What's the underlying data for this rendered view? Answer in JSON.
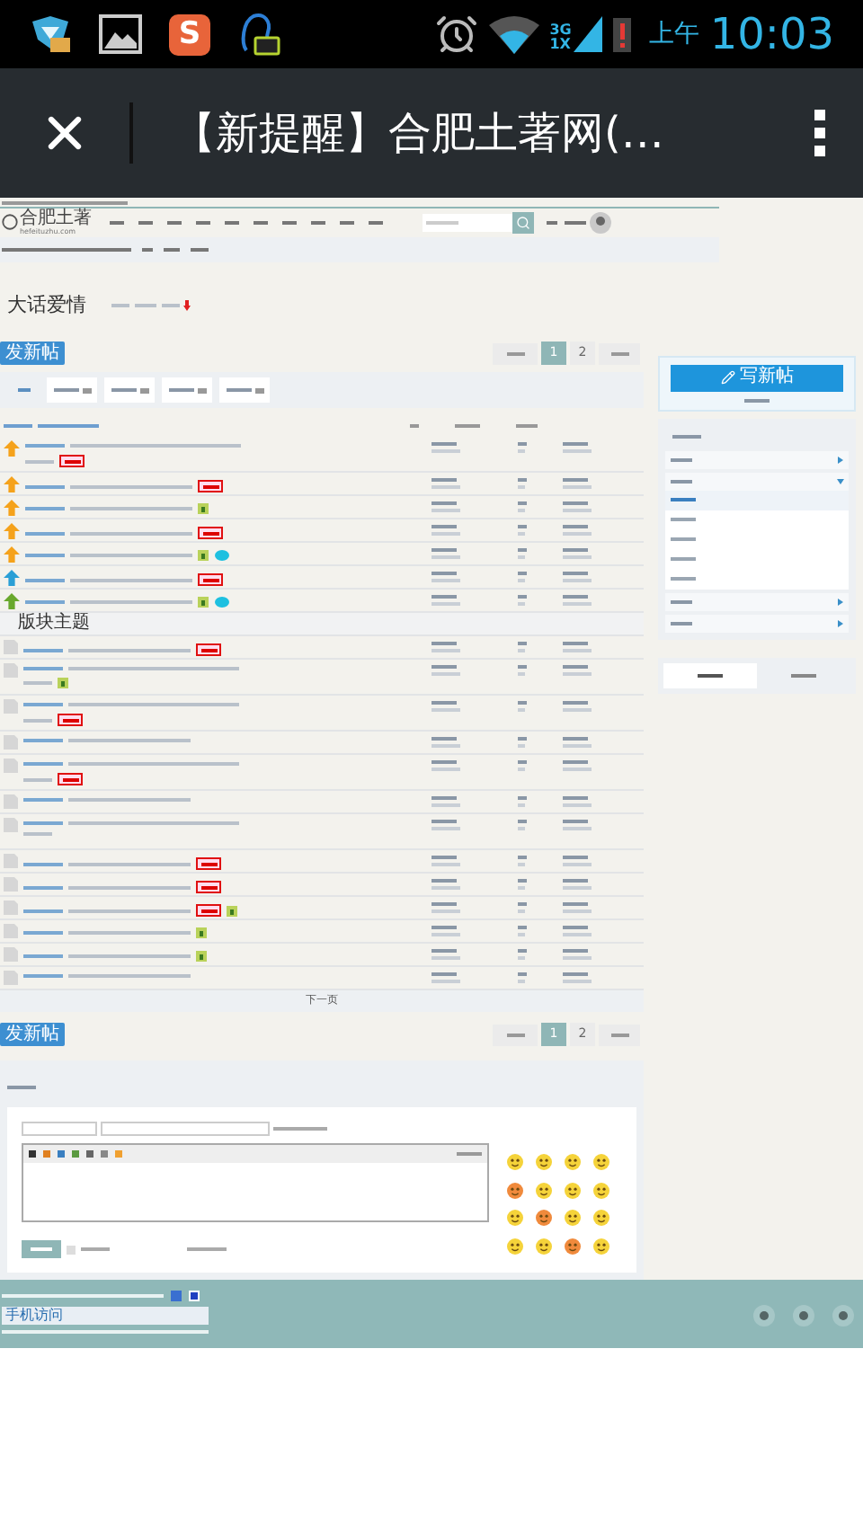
{
  "status_bar": {
    "notifications": [
      {
        "kind": "shield"
      },
      {
        "kind": "gallery"
      },
      {
        "kind": "letter",
        "label": "S"
      },
      {
        "kind": "chat"
      }
    ],
    "network": "3G",
    "network_2": "1X",
    "period": "上午",
    "time": "10:03"
  },
  "browser": {
    "title": "【新提醒】合肥土著网(…"
  },
  "site": {
    "logo": "合肥土著",
    "domain": "hefeituzhu.com"
  },
  "forum": {
    "title": "大话爱情",
    "post_button": "发新帖",
    "pager": [
      {
        "label": "1",
        "selected": true
      },
      {
        "label": "2",
        "selected": false
      }
    ],
    "sticky_threads": [
      {
        "color": "#f5a21b",
        "two_line": true,
        "hot": true,
        "image": false,
        "badge": false
      },
      {
        "color": "#f5a21b",
        "two_line": false,
        "hot": true,
        "image": false,
        "badge": false
      },
      {
        "color": "#f5a21b",
        "two_line": false,
        "hot": false,
        "image": true,
        "badge": false
      },
      {
        "color": "#f5a21b",
        "two_line": false,
        "hot": true,
        "image": false,
        "badge": false
      },
      {
        "color": "#f5a21b",
        "two_line": false,
        "hot": false,
        "image": true,
        "badge": true
      },
      {
        "color": "#2a9fd6",
        "two_line": false,
        "hot": true,
        "image": false,
        "badge": false
      },
      {
        "color": "#69a82c",
        "two_line": false,
        "hot": false,
        "image": true,
        "badge": true
      }
    ],
    "section_title": "版块主题",
    "threads": [
      {
        "two_line": false,
        "hot": true,
        "image": false
      },
      {
        "two_line": true,
        "hot": false,
        "image": true
      },
      {
        "two_line": true,
        "hot": true,
        "image": false
      },
      {
        "two_line": false,
        "hot": false,
        "image": false
      },
      {
        "two_line": true,
        "hot": true,
        "image": false
      },
      {
        "two_line": false,
        "hot": false,
        "image": false
      },
      {
        "two_line": true,
        "hot": false,
        "image": false
      },
      {
        "two_line": false,
        "hot": true,
        "image": false
      },
      {
        "two_line": false,
        "hot": true,
        "image": false
      },
      {
        "two_line": false,
        "hot": true,
        "image": true
      },
      {
        "two_line": false,
        "hot": false,
        "image": true
      },
      {
        "two_line": false,
        "hot": false,
        "image": true
      },
      {
        "two_line": false,
        "hot": false,
        "image": false
      }
    ],
    "next_page": "下一页",
    "bottom_post_button": "发新帖",
    "bottom_pager": [
      {
        "label": "1",
        "selected": true
      },
      {
        "label": "2",
        "selected": false
      }
    ],
    "reply_option": {
      "checked": false
    }
  },
  "sidebar": {
    "new_post_button": "写新帖",
    "groups": [
      {
        "expanded": false
      },
      {
        "expanded": true,
        "children": [
          {
            "selected": true
          },
          {
            "selected": false
          },
          {
            "selected": false
          },
          {
            "selected": false
          },
          {
            "selected": false
          }
        ]
      },
      {
        "expanded": false
      },
      {
        "expanded": false
      }
    ],
    "tabs": [
      {
        "selected": true
      },
      {
        "selected": false
      }
    ]
  },
  "footer_badge": {
    "label": "手机访问"
  }
}
